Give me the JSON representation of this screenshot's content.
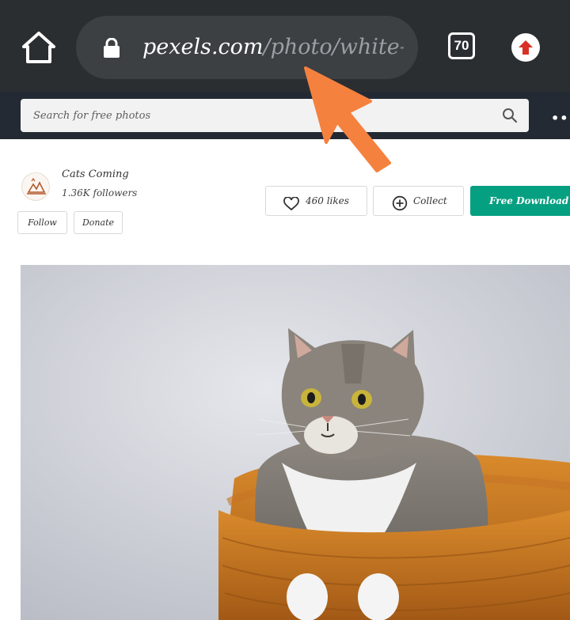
{
  "browser": {
    "url_host": "pexels.com",
    "url_path": "/photo/white-a",
    "tab_count": "70",
    "icons": {
      "home": "home-icon",
      "lock": "lock-icon",
      "update": "update-icon"
    },
    "colors": {
      "toolbar_bg": "#2b2e31",
      "urlbar_bg": "#3c4043",
      "update_arrow": "#d93025"
    }
  },
  "site": {
    "search_placeholder": "Search for free photos",
    "more_icon": "more-dots-icon",
    "colors": {
      "header_bg": "#232a34"
    }
  },
  "photographer": {
    "name": "Cats Coming",
    "followers": "1.36K followers",
    "follow_label": "Follow",
    "donate_label": "Donate"
  },
  "actions": {
    "likes_label": "460 likes",
    "collect_label": "Collect",
    "download_label": "Free Download",
    "colors": {
      "download_bg": "#05a081"
    }
  },
  "photo": {
    "subject_icon": "cat-in-basket-photo"
  },
  "annotation": {
    "color": "#f5813f",
    "icon": "pointer-arrow"
  }
}
